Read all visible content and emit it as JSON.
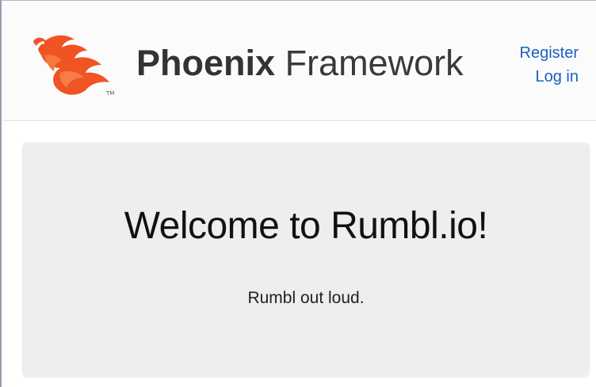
{
  "header": {
    "brand_bold": "Phoenix",
    "brand_light": "Framework",
    "logo_icon": "phoenix-bird-icon",
    "logo_trademark": "TM",
    "nav": {
      "register": "Register",
      "login": "Log in"
    }
  },
  "main": {
    "title": "Welcome to Rumbl.io!",
    "subtitle": "Rumbl out loud."
  },
  "colors": {
    "accent": "#f05423",
    "link": "#1a5fc4",
    "jumbotron_bg": "#eeeeee"
  }
}
